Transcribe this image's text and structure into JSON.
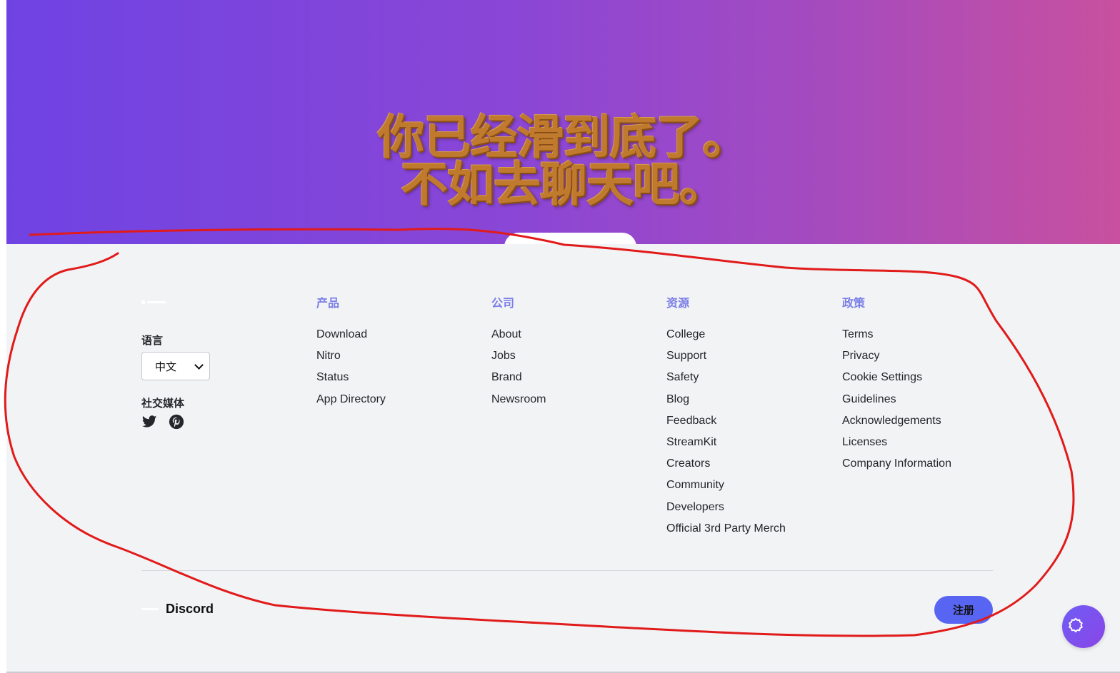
{
  "hero": {
    "line1": "你已经滑到底了。",
    "line2": "不如去聊天吧。"
  },
  "brand": {
    "language_label": "语言",
    "language_value": "中文",
    "social_label": "社交媒体",
    "social_icons": [
      "twitter-icon",
      "pinterest-icon"
    ]
  },
  "columns": [
    {
      "title": "产品",
      "links": [
        "Download",
        "Nitro",
        "Status",
        "App Directory"
      ]
    },
    {
      "title": "公司",
      "links": [
        "About",
        "Jobs",
        "Brand",
        "Newsroom"
      ]
    },
    {
      "title": "资源",
      "links": [
        "College",
        "Support",
        "Safety",
        "Blog",
        "Feedback",
        "StreamKit",
        "Creators",
        "Community",
        "Developers",
        "Official 3rd Party Merch"
      ]
    },
    {
      "title": "政策",
      "links": [
        "Terms",
        "Privacy",
        "Cookie Settings",
        "Guidelines",
        "Acknowledgements",
        "Licenses",
        "Company Information"
      ]
    }
  ],
  "footer": {
    "brand_name": "Discord",
    "signup_label": "注册"
  },
  "colors": {
    "accent": "#5865f2",
    "column_title": "#7b7fe6",
    "annotation": "#e11a1a"
  }
}
